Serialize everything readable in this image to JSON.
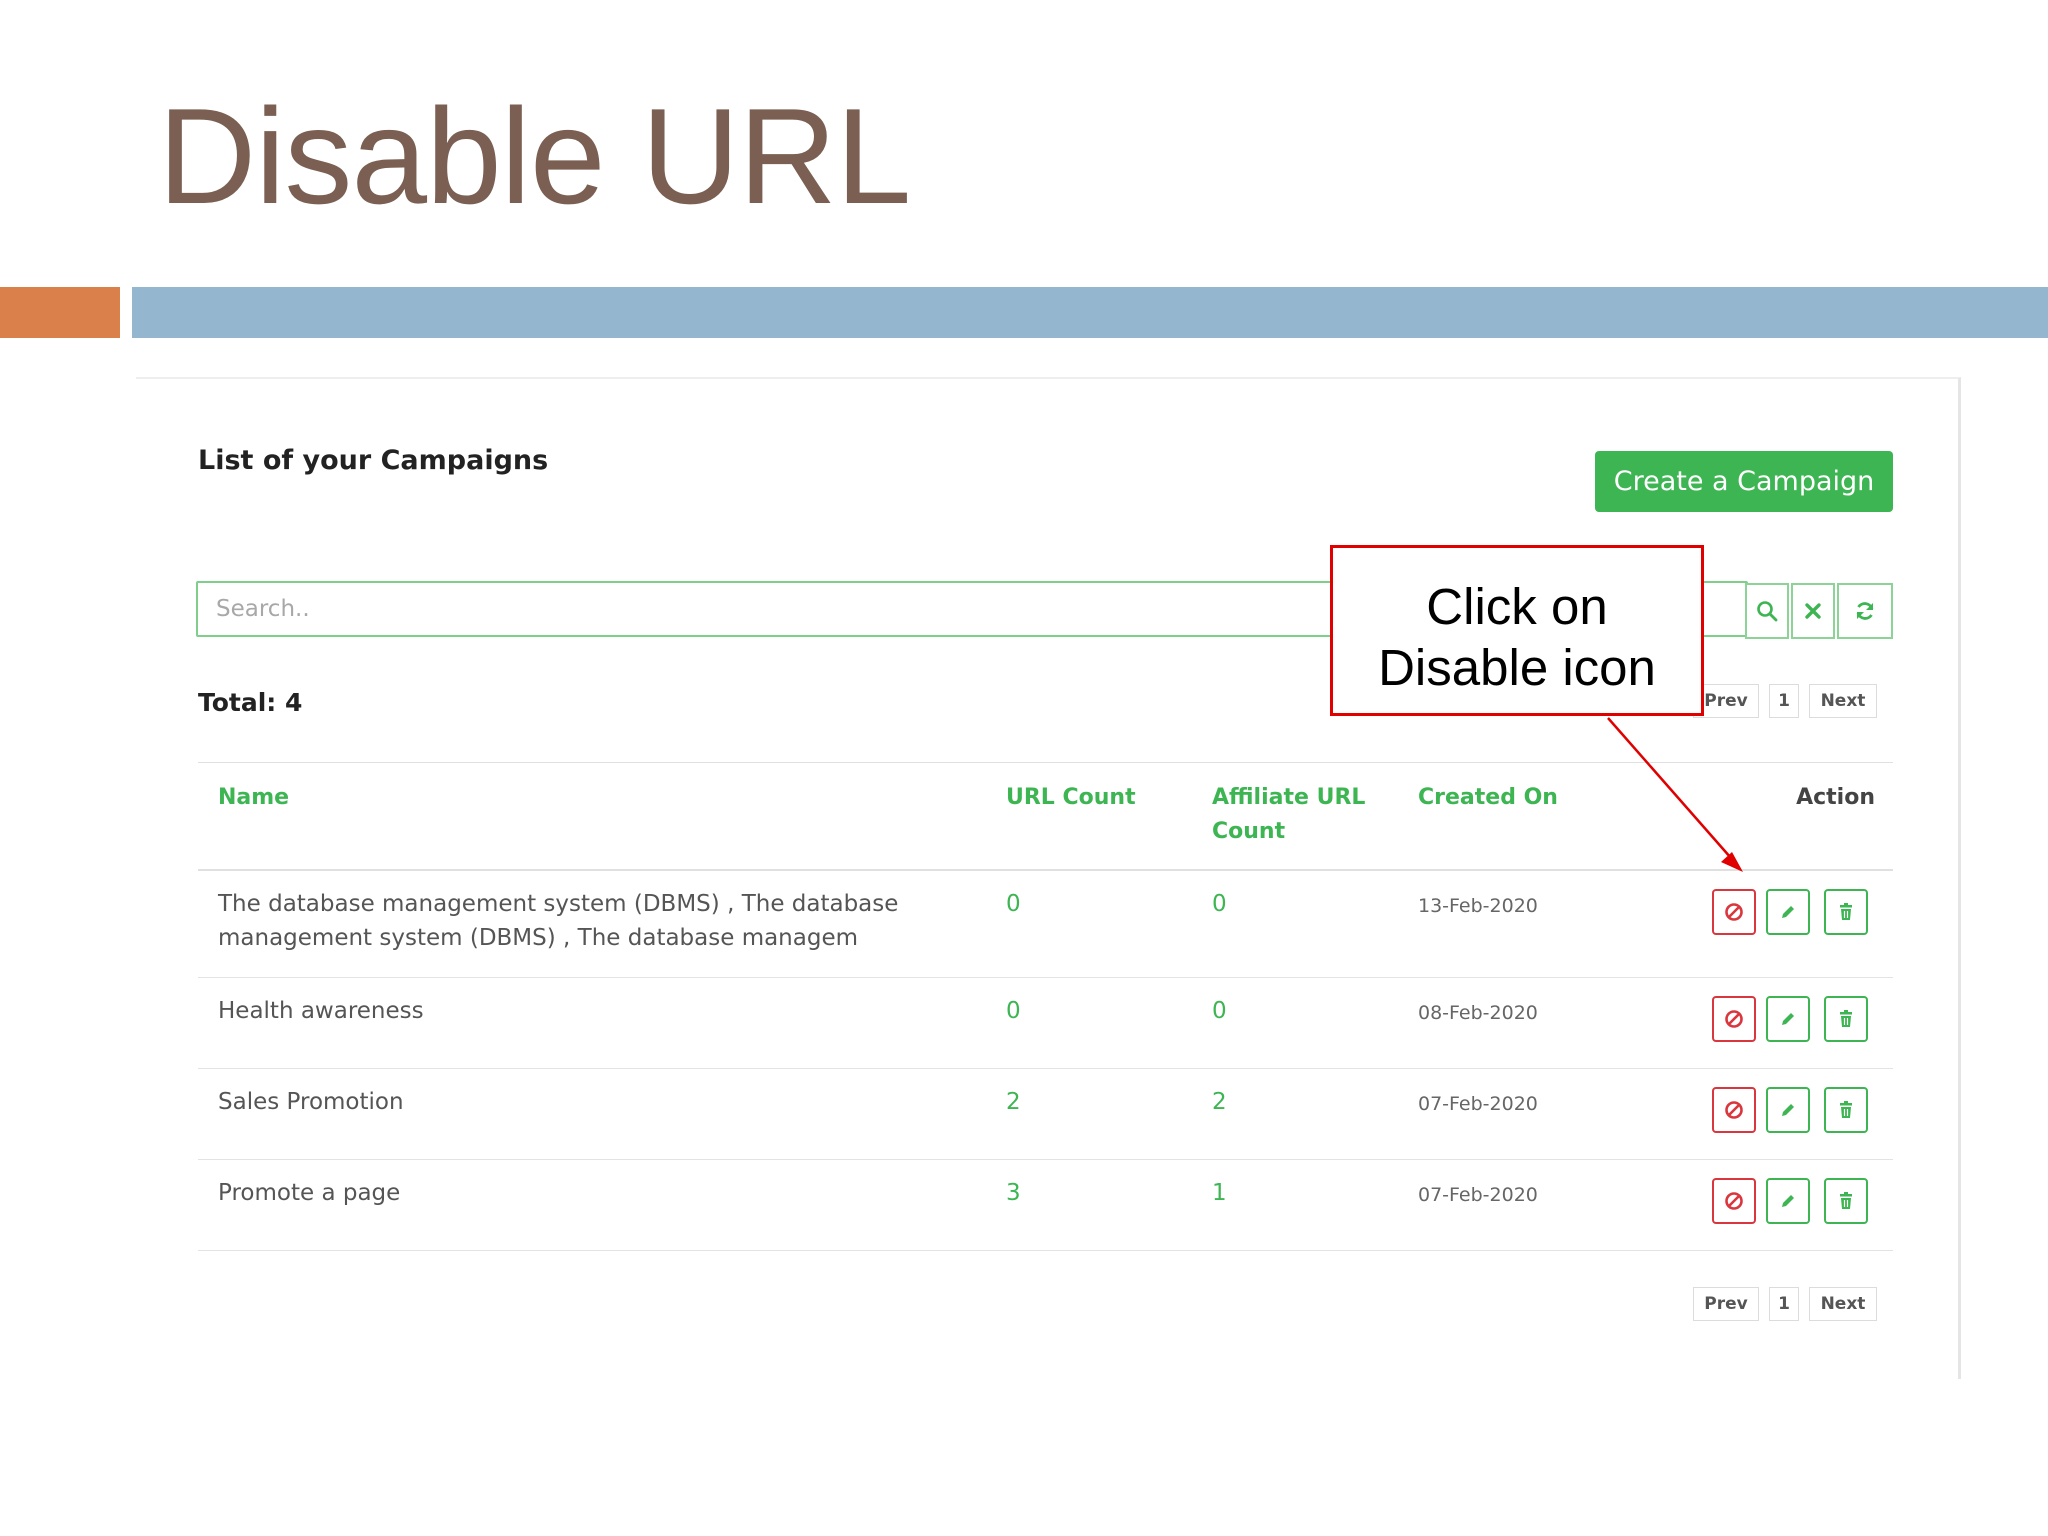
{
  "slide": {
    "title": "Disable URL"
  },
  "panel": {
    "title": "List of your Campaigns",
    "create_button": "Create a Campaign",
    "search": {
      "placeholder": "Search.."
    },
    "total_label": "Total: 4",
    "pager": {
      "prev": "Prev",
      "page": "1",
      "next": "Next"
    },
    "columns": {
      "name": "Name",
      "url_count": "URL Count",
      "affiliate_line1": "Affiliate URL",
      "affiliate_line2": "Count",
      "created_on": "Created On",
      "action": "Action"
    },
    "rows": [
      {
        "name_line1": "The database management system (DBMS) , The database",
        "name_line2": "management system (DBMS) , The database managem",
        "url_count": "0",
        "affiliate_count": "0",
        "created_on": "13-Feb-2020"
      },
      {
        "name_line1": "Health awareness",
        "name_line2": "",
        "url_count": "0",
        "affiliate_count": "0",
        "created_on": "08-Feb-2020"
      },
      {
        "name_line1": "Sales Promotion",
        "name_line2": "",
        "url_count": "2",
        "affiliate_count": "2",
        "created_on": "07-Feb-2020"
      },
      {
        "name_line1": "Promote a page",
        "name_line2": "",
        "url_count": "3",
        "affiliate_count": "1",
        "created_on": "07-Feb-2020"
      }
    ]
  },
  "callout": {
    "line1": "Click on",
    "line2": "Disable icon"
  },
  "icons": {
    "search": "search-icon",
    "clear": "close-icon",
    "refresh": "refresh-icon",
    "disable": "ban-icon",
    "edit": "pencil-icon",
    "delete": "trash-icon"
  },
  "colors": {
    "accent_green": "#3db552",
    "disable_red": "#d9363e",
    "title_brown": "#7a5f52",
    "bar_blue": "#94b6cf",
    "bar_orange": "#d9804b",
    "callout_red": "#e00000"
  }
}
